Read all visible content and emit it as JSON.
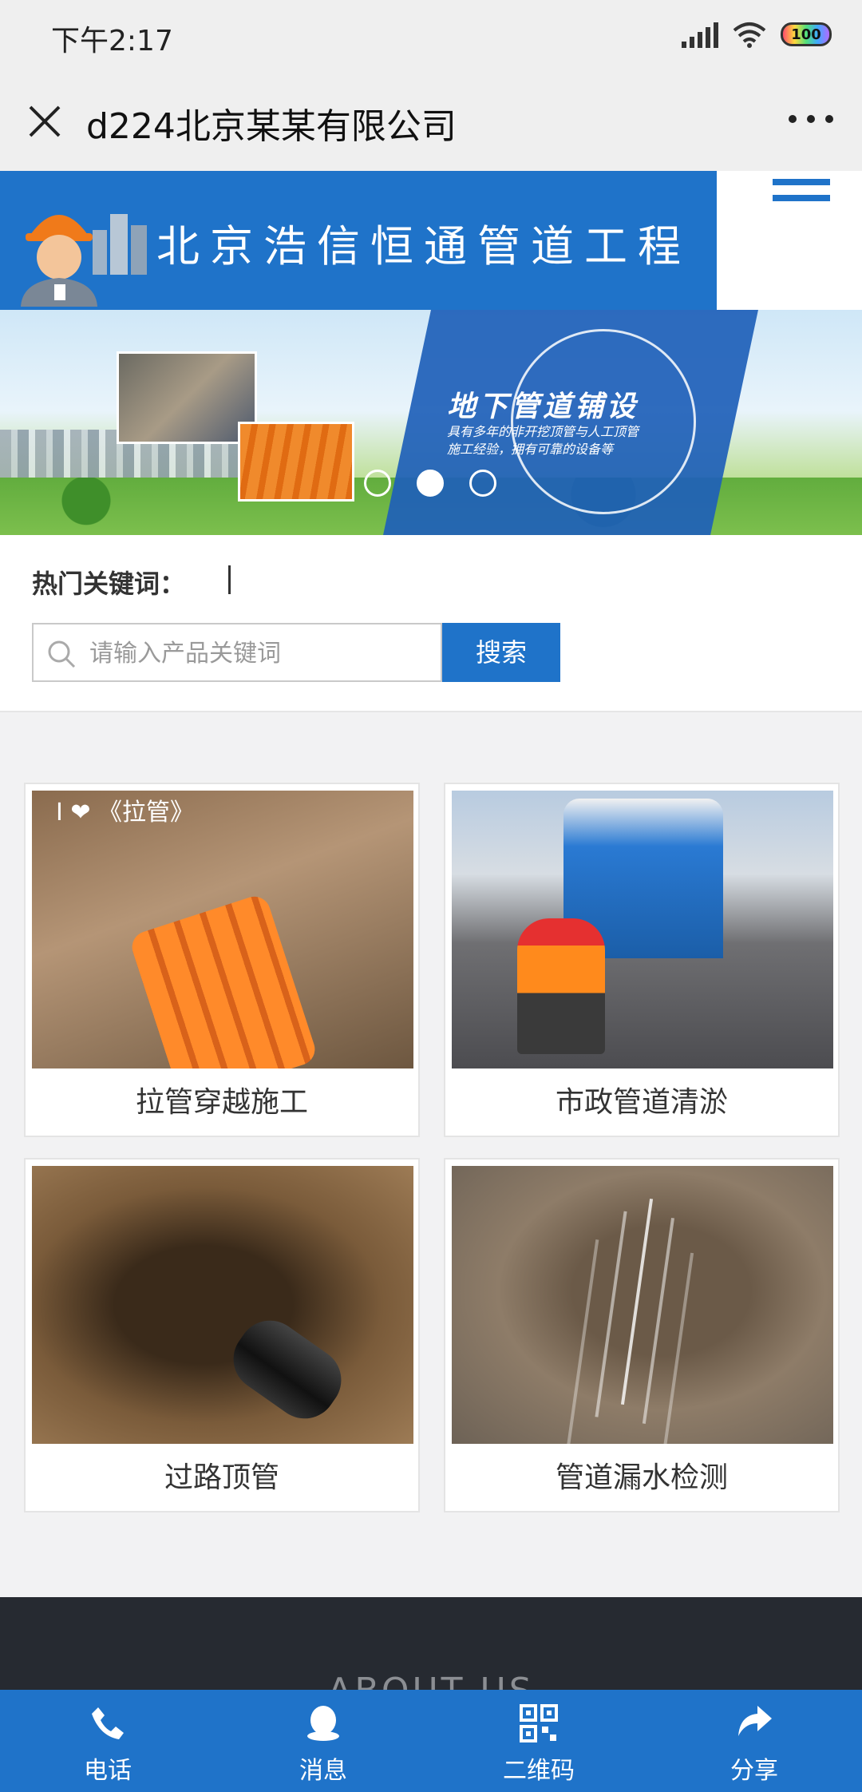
{
  "status": {
    "time": "下午2:17",
    "battery": "100"
  },
  "nav": {
    "title": "d224北京某某有限公司"
  },
  "header": {
    "brand": "北京浩信恒通管道工程"
  },
  "banner": {
    "title": "地下管道铺设",
    "subtitle_line1": "具有多年的非开挖顶管与人工顶管",
    "subtitle_line2": "施工经验，拥有可靠的设备等",
    "active_slide": 2,
    "slide_count": 3
  },
  "search": {
    "hot_label": "热门关键词：",
    "placeholder": "请输入产品关键词",
    "button": "搜索"
  },
  "products": [
    {
      "title": "拉管穿越施工",
      "image_tag": "I ❤ 《拉管》"
    },
    {
      "title": "市政管道清淤"
    },
    {
      "title": "过路顶管"
    },
    {
      "title": "管道漏水检测"
    }
  ],
  "about": {
    "heading": "ABOUT US"
  },
  "bottom_tabs": [
    {
      "label": "电话",
      "icon": "phone-icon"
    },
    {
      "label": "消息",
      "icon": "chat-icon"
    },
    {
      "label": "二维码",
      "icon": "qrcode-icon"
    },
    {
      "label": "分享",
      "icon": "share-icon"
    }
  ]
}
